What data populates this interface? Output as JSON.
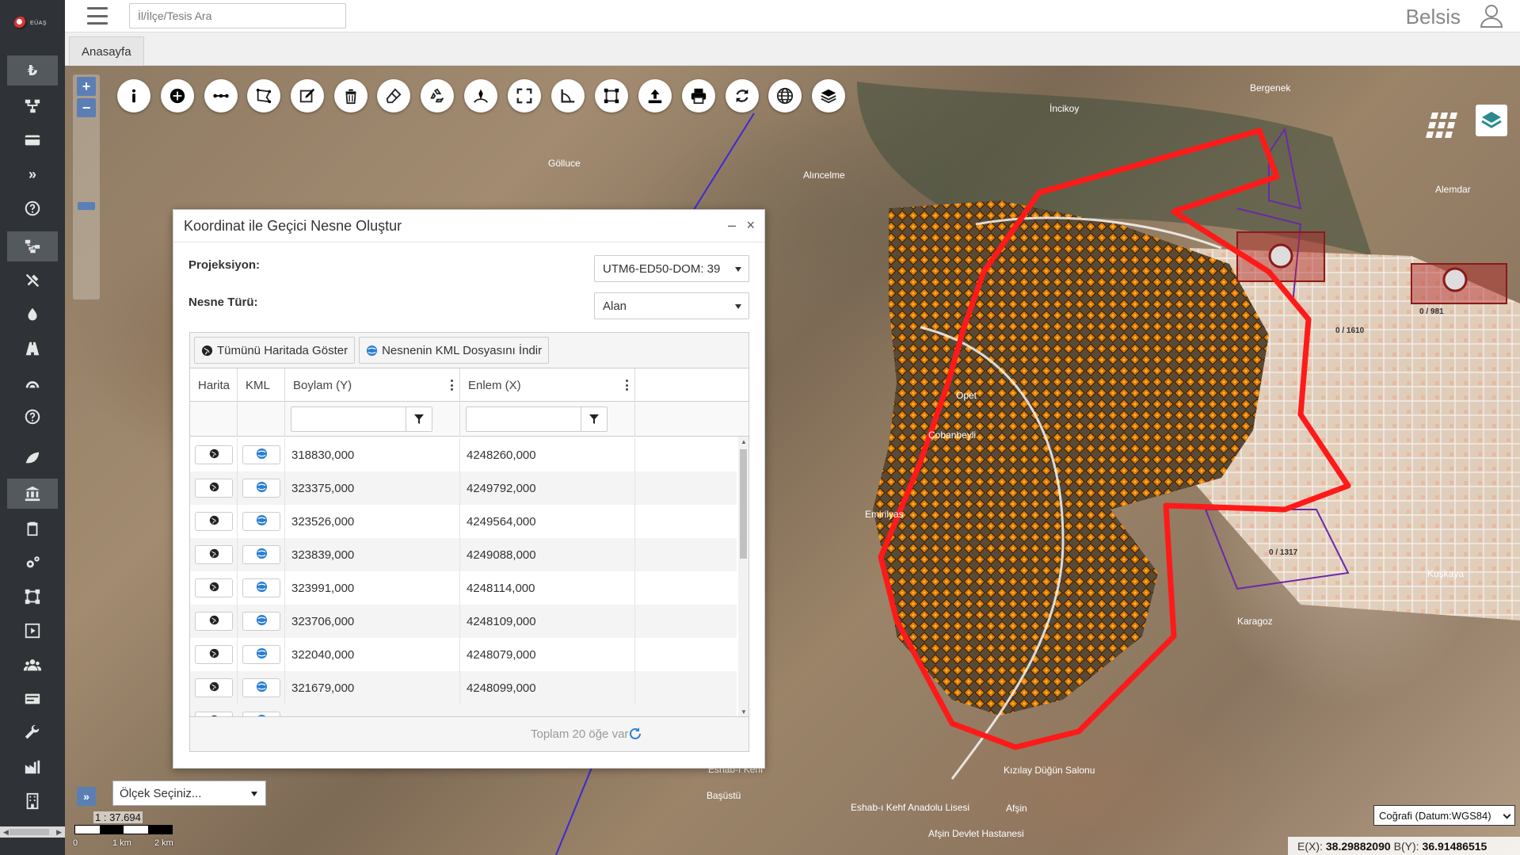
{
  "header": {
    "search_placeholder": "İl/İlçe/Tesis Ara",
    "brand": "Belsis"
  },
  "tabs": [
    {
      "label": "Anasayfa"
    }
  ],
  "map_controls": {
    "zoom_in": "+",
    "zoom_out": "−",
    "toolbar": [
      "info-icon",
      "add-circle-icon",
      "measure-line-icon",
      "polygon-select-icon",
      "edit-icon",
      "trash-icon",
      "eraser-icon",
      "recycle-icon",
      "draw-path-icon",
      "fullscreen-icon",
      "measure-angle-icon",
      "frame-icon",
      "upload-icon",
      "print-icon",
      "refresh-icon",
      "globe-icon",
      "layers-icon"
    ]
  },
  "dialog": {
    "title": "Koordinat ile Geçici Nesne Oluştur",
    "minimize": "–",
    "close": "×",
    "projection_label": "Projeksiyon:",
    "projection_value": "UTM6-ED50-DOM: 39",
    "object_type_label": "Nesne Türü:",
    "object_type_value": "Alan",
    "btn_show_all": "Tümünü Haritada Göster",
    "btn_download_kml": "Nesnenin KML Dosyasını İndir",
    "columns": {
      "map": "Harita",
      "kml": "KML",
      "lon": "Boylam (Y)",
      "lat": "Enlem (X)"
    },
    "rows": [
      {
        "lon": "318830,000",
        "lat": "4248260,000"
      },
      {
        "lon": "323375,000",
        "lat": "4249792,000"
      },
      {
        "lon": "323526,000",
        "lat": "4249564,000"
      },
      {
        "lon": "323839,000",
        "lat": "4249088,000"
      },
      {
        "lon": "323991,000",
        "lat": "4248114,000"
      },
      {
        "lon": "323706,000",
        "lat": "4248109,000"
      },
      {
        "lon": "322040,000",
        "lat": "4248079,000"
      },
      {
        "lon": "321679,000",
        "lat": "4248099,000"
      }
    ],
    "footer_total": "Toplam 20 öğe var"
  },
  "map_labels": {
    "place_1": "Bergenek",
    "place_2": "İncikoy",
    "place_3": "Gölluce",
    "place_4": "Alıncelme",
    "place_5": "Opet",
    "place_6": "Çobanbeyli",
    "place_7": "Emirilyas",
    "place_8": "Alemdar",
    "place_9": "Kuşkaya",
    "place_10": "Karagoz",
    "place_11": "Eshab-ı Kehf",
    "place_12": "Başüstü",
    "place_13": "Kızılay Düğün Salonu",
    "place_14": "Afşin Devlet Hastanesi",
    "place_15": "Afşin",
    "place_16": "Eshab-ı Kehf Anadolu Lisesi",
    "parcel_1": "0 / 1317",
    "parcel_2": "0 / 1610",
    "parcel_3": "0 / 981"
  },
  "scale": {
    "select_placeholder": "Ölçek Seçiniz...",
    "ratio": "1 : 37.694",
    "label_0": "0",
    "label_1": "1 km",
    "label_2": "2 km"
  },
  "coords": {
    "projection": "Coğrafi (Datum:WGS84)",
    "ex_label": "E(X):",
    "ex_value": "38.29882090",
    "by_label": "B(Y):",
    "by_value": "36.91486515"
  },
  "colors": {
    "sidebar": "#2f3337",
    "boundary": "#ff1a1a",
    "parcel": "#e07b00",
    "accent": "#5b7fb4"
  }
}
